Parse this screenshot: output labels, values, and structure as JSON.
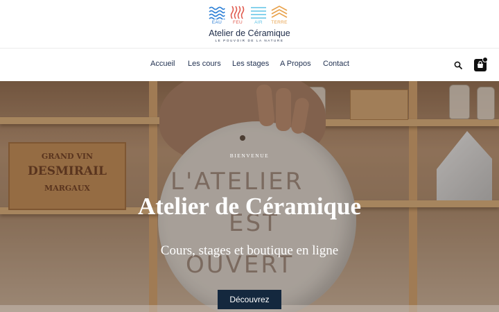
{
  "logo": {
    "elements": [
      {
        "label": "EAU",
        "color": "#2c7fd6",
        "icon": "wave-icon"
      },
      {
        "label": "FEU",
        "color": "#e05a4e",
        "icon": "flame-icon"
      },
      {
        "label": "AIR",
        "color": "#5ec3e6",
        "icon": "air-icon"
      },
      {
        "label": "TERRE",
        "color": "#e8a14a",
        "icon": "mountain-icon"
      }
    ],
    "title": "Atelier de Céramique",
    "tagline": "LE POUVOIR DE LA NATURE"
  },
  "nav": {
    "items": [
      "Accueil",
      "Les cours",
      "Les stages",
      "A Propos",
      "Contact"
    ],
    "search_icon": "search-icon",
    "cart_icon": "shopping-bag-icon"
  },
  "hero": {
    "pretitle": "BIENVENUE",
    "title": "Atelier de Céramique",
    "subtitle": "Cours, stages et boutique en ligne",
    "cta": "Découvrez",
    "background_photo": {
      "crate_text": [
        "GRAND VIN",
        "DESMIRAIL",
        "MARGAUX"
      ],
      "sign_text": [
        "L'ATELIER",
        "EST",
        "OUVERT"
      ]
    }
  },
  "colors": {
    "navy": "#14283e",
    "nav_text": "#1f2f4f"
  }
}
